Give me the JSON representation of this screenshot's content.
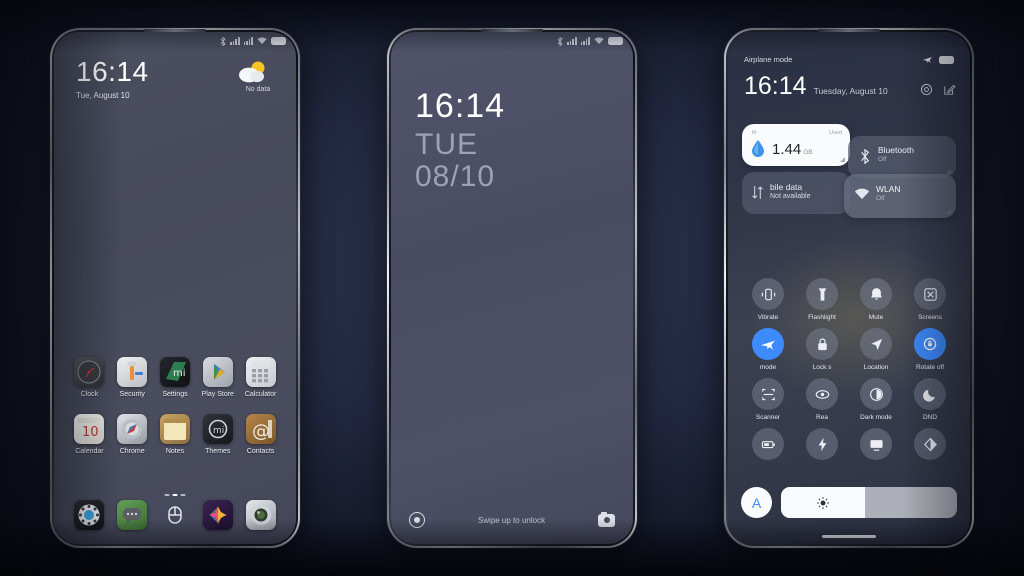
{
  "theme": {
    "accent": "#3d8bff",
    "background": "#151a2b",
    "screen_bg_home": "#4a4d5e",
    "screen_bg_lock": "#4d5066",
    "screen_bg_cc": "#343949",
    "card_light": "#fafbfc",
    "text_light": "#ffffff"
  },
  "phone1": {
    "name": "Home screen",
    "status_bar": {
      "bluetooth": "bluetooth-icon",
      "signal1": "signal-bars-icon",
      "signal2": "signal-bars-icon",
      "wifi": "wifi-icon",
      "battery": "battery-icon"
    },
    "clock": {
      "time": "16:14",
      "date": "Tue, August 10"
    },
    "weather": {
      "label": "No data",
      "icon": "partly-cloudy-icon"
    },
    "apps": [
      {
        "label": "Clock",
        "icon": "clock-app-icon"
      },
      {
        "label": "Security",
        "icon": "security-app-icon"
      },
      {
        "label": "Settings",
        "icon": "settings-app-icon"
      },
      {
        "label": "Play Store",
        "icon": "play-store-app-icon"
      },
      {
        "label": "Calculator",
        "icon": "calculator-app-icon"
      },
      {
        "label": "Calendar",
        "icon": "calendar-app-icon"
      },
      {
        "label": "Chrome",
        "icon": "chrome-app-icon"
      },
      {
        "label": "Notes",
        "icon": "notes-app-icon"
      },
      {
        "label": "Themes",
        "icon": "themes-app-icon"
      },
      {
        "label": "Contacts",
        "icon": "contacts-app-icon"
      }
    ],
    "page_dots": 3,
    "active_dot": 1,
    "dock": [
      {
        "label": "Phone",
        "icon": "phone-dialer-icon"
      },
      {
        "label": "Messaging",
        "icon": "messaging-icon"
      },
      {
        "label": "Browser",
        "icon": "browser-icon"
      },
      {
        "label": "Gallery",
        "icon": "gallery-icon"
      },
      {
        "label": "Camera",
        "icon": "camera-icon"
      }
    ]
  },
  "phone2": {
    "name": "Lock screen",
    "status_bar": {
      "bluetooth": "bluetooth-icon",
      "signal1": "signal-bars-icon",
      "signal2": "signal-bars-icon",
      "wifi": "wifi-icon",
      "battery": "battery-icon"
    },
    "time": "16:14",
    "day_of_week": "TUE",
    "date": "08/10",
    "hint": "Swipe up to unlock",
    "left_shortcut": "flashlight-ring-icon",
    "right_shortcut": "camera-icon"
  },
  "phone3": {
    "name": "Control center",
    "airplane_label": "Airplane mode",
    "airplane_icon": "airplane-icon",
    "battery_icon": "battery-icon",
    "time": "16:14",
    "date": "Tuesday, August 10",
    "actions": [
      {
        "name": "settings-gear",
        "icon": "gear-icon"
      },
      {
        "name": "edit-toggles",
        "icon": "edit-pencil-icon"
      }
    ],
    "cards": [
      {
        "id": "data-usage",
        "icon": "water-drop-icon",
        "header_left": "th",
        "header_right": "Used",
        "value": "1.44",
        "unit": "GB"
      },
      {
        "id": "mobile-data",
        "icon": "mobile-data-arrows-icon",
        "title": "bile data",
        "sub": "Not available"
      },
      {
        "id": "bluetooth",
        "icon": "bluetooth-icon",
        "title": "Bluetooth",
        "sub": "Off"
      },
      {
        "id": "wlan",
        "icon": "wifi-icon",
        "title": "WLAN",
        "sub": "Off"
      }
    ],
    "toggles": [
      {
        "label": "Vibrate",
        "icon": "vibrate-icon",
        "on": false,
        "ghost": false
      },
      {
        "label": "Flashlight",
        "icon": "flashlight-icon",
        "on": false,
        "ghost": false
      },
      {
        "label": "Mute",
        "icon": "bell-mute-icon",
        "on": false,
        "ghost": false
      },
      {
        "label": "Screens",
        "icon": "screenshot-icon",
        "on": false,
        "ghost": false
      },
      {
        "label": "mode",
        "icon": "airplane-icon",
        "on": true,
        "ghost": false
      },
      {
        "label": "Lock s",
        "icon": "lock-icon",
        "on": false,
        "ghost": false
      },
      {
        "label": "Location",
        "icon": "location-arrow-icon",
        "on": false,
        "ghost": false
      },
      {
        "label": "Rotate off",
        "icon": "rotate-lock-icon",
        "on": true,
        "ghost": false
      },
      {
        "label": "Scanner",
        "icon": "qr-scanner-icon",
        "on": false,
        "ghost": false
      },
      {
        "label": "Rea",
        "icon": "eye-icon",
        "on": false,
        "ghost": false
      },
      {
        "label": "Dark mode",
        "icon": "contrast-circle-icon",
        "on": false,
        "ghost": false
      },
      {
        "label": "DND",
        "icon": "moon-icon",
        "on": false,
        "ghost": false
      },
      {
        "label": "",
        "icon": "battery-saver-icon",
        "on": false,
        "ghost": false
      },
      {
        "label": "",
        "icon": "lightning-icon",
        "on": false,
        "ghost": false
      },
      {
        "label": "",
        "icon": "cast-screen-icon",
        "on": false,
        "ghost": false
      },
      {
        "label": "",
        "icon": "half-contrast-icon",
        "on": false,
        "ghost": false
      }
    ],
    "brightness": {
      "auto_label": "A",
      "icon": "sun-icon",
      "percent": 48
    }
  }
}
